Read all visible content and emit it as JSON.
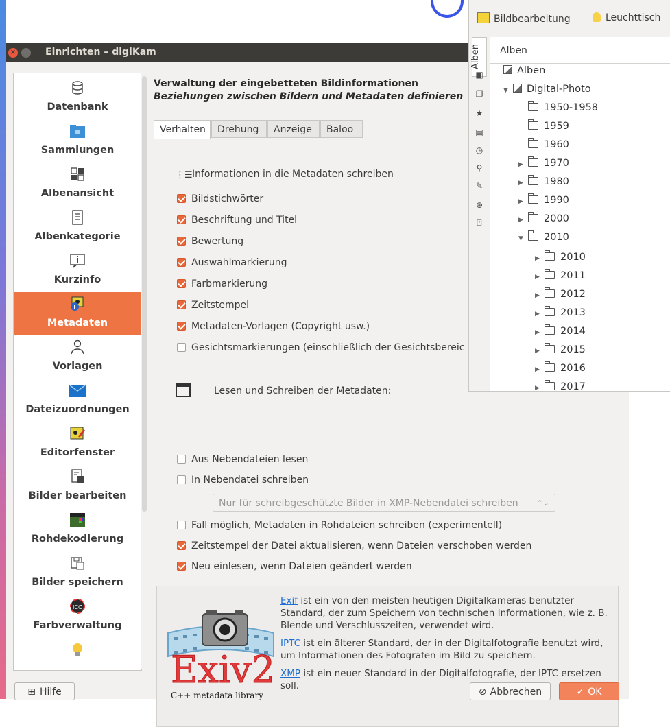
{
  "dialog": {
    "title": "Einrichten – digiKam",
    "close_glyph": "×",
    "header_title": "Verwaltung der eingebetteten Bildinformationen",
    "header_subtitle": "Beziehungen zwischen Bildern und Metadaten definieren"
  },
  "sidebar": {
    "items": [
      {
        "label": "Datenbank",
        "icon": "database-icon"
      },
      {
        "label": "Sammlungen",
        "icon": "collections-folder-icon"
      },
      {
        "label": "Albenansicht",
        "icon": "album-view-grid-icon"
      },
      {
        "label": "Albenkategorie",
        "icon": "album-category-icon"
      },
      {
        "label": "Kurzinfo",
        "icon": "tooltip-info-icon"
      },
      {
        "label": "Metadaten",
        "icon": "metadata-info-icon"
      },
      {
        "label": "Vorlagen",
        "icon": "templates-person-icon"
      },
      {
        "label": "Dateizuordnungen",
        "icon": "file-mime-folder-icon"
      },
      {
        "label": "Editorfenster",
        "icon": "editor-window-icon"
      },
      {
        "label": "Bilder bearbeiten",
        "icon": "image-edit-icon"
      },
      {
        "label": "Rohdekodierung",
        "icon": "raw-decoding-icon"
      },
      {
        "label": "Bilder speichern",
        "icon": "save-images-icon"
      },
      {
        "label": "Farbverwaltung",
        "icon": "icc-color-management-icon"
      }
    ]
  },
  "tabs": [
    "Verhalten",
    "Drehung",
    "Anzeige",
    "Baloo"
  ],
  "write_section": {
    "title": "Informationen in die Metadaten schreiben",
    "options": [
      {
        "label": "Bildstichwörter",
        "checked": true
      },
      {
        "label": "Beschriftung und Titel",
        "checked": true
      },
      {
        "label": "Bewertung",
        "checked": true
      },
      {
        "label": "Auswahlmarkierung",
        "checked": true
      },
      {
        "label": "Farbmarkierung",
        "checked": true
      },
      {
        "label": "Zeitstempel",
        "checked": true
      },
      {
        "label": "Metadaten-Vorlagen (Copyright usw.)",
        "checked": true
      },
      {
        "label": "Gesichtsmarkierungen (einschließlich der Gesichtsbereic",
        "checked": false
      }
    ]
  },
  "rw_section": {
    "title": "Lesen und Schreiben der Metadaten:",
    "opt_read_sidecar": {
      "label": "Aus Nebendateien lesen",
      "checked": false
    },
    "opt_write_sidecar": {
      "label": "In Nebendatei schreiben",
      "checked": false
    },
    "sidecar_mode": "Nur für schreibgeschützte Bilder in XMP-Nebendatei schreiben",
    "opt_raw": {
      "label": "Fall möglich, Metadaten in Rohdateien schreiben (experimentell)",
      "checked": false
    },
    "opt_timestamp": {
      "label": "Zeitstempel der Datei aktualisieren, wenn Dateien verschoben werden",
      "checked": true
    },
    "opt_reread": {
      "label": "Neu einlesen, wenn Dateien geändert werden",
      "checked": true
    }
  },
  "exiv": {
    "logo_text": "Exiv2",
    "logo_caption": "C++ metadata library",
    "exif_link": "Exif",
    "exif_text": " ist ein von den meisten heutigen Digitalkameras benutzter Standard, der zum Speichern von technischen Informationen, wie z. B. Blende und Verschlusszeiten, verwendet wird.",
    "iptc_link": "IPTC",
    "iptc_text": " ist ein älterer Standard, der in der Digitalfotografie benutzt wird, um Informationen des Fotografen im Bild zu speichern.",
    "xmp_link": "XMP",
    "xmp_text": " ist ein neuer Standard in der Digitalfotografie, der IPTC ersetzen soll."
  },
  "footer": {
    "help": "Hilfe",
    "cancel": "Abbrechen",
    "ok": "OK"
  },
  "albums_panel": {
    "toolbar_edit": "Bildbearbeitung",
    "toolbar_lighttable": "Leuchttisch",
    "side_tab": "Alben",
    "column_header": "Alben",
    "root": "Alben",
    "collection": "Digital-Photo",
    "years": [
      {
        "label": "1950-1958",
        "expander": ""
      },
      {
        "label": "1959",
        "expander": ""
      },
      {
        "label": "1960",
        "expander": ""
      },
      {
        "label": "1970",
        "expander": "▶"
      },
      {
        "label": "1980",
        "expander": "▶"
      },
      {
        "label": "1990",
        "expander": "▶"
      },
      {
        "label": "2000",
        "expander": "▶"
      },
      {
        "label": "2010",
        "expander": "▼"
      }
    ],
    "subyears": [
      "2010",
      "2011",
      "2012",
      "2013",
      "2014",
      "2015",
      "2016",
      "2017"
    ]
  },
  "colors": {
    "accent": "#ee7543",
    "titlebar": "#3c3b37",
    "link": "#1f6fd0"
  }
}
